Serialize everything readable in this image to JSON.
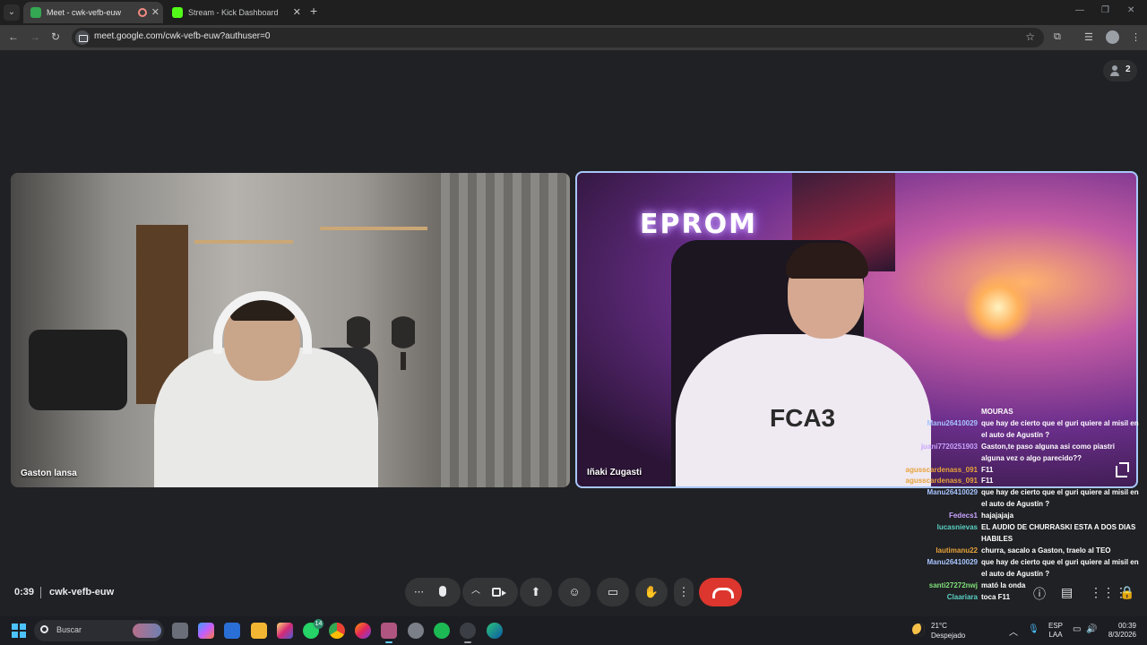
{
  "browser": {
    "tabs": [
      {
        "title": "Meet - cwk-vefb-euw",
        "active": true,
        "favicon_color": "#34a853"
      },
      {
        "title": "Stream - Kick Dashboard",
        "active": false,
        "favicon_color": "#53fc18"
      }
    ],
    "url": "meet.google.com/cwk-vefb-euw?authuser=0"
  },
  "meet": {
    "participant_count": "2",
    "tiles": [
      {
        "name": "Gaston lansa"
      },
      {
        "name": "Iñaki Zugasti"
      }
    ],
    "neon_sign": "EPROM",
    "shirt_text": "FCA3",
    "chat": [
      {
        "user": "",
        "text": "MOURAS",
        "color": "#ffffff"
      },
      {
        "user": "Manu26410029",
        "text": "que hay de cierto que el guri quiere al misil en el auto de Agustín ?",
        "color": "#a7c4ff"
      },
      {
        "user": "juani7720251903",
        "text": "Gaston,te paso alguna asi como piastri alguna vez o algo parecido??",
        "color": "#c9a3ff"
      },
      {
        "user": "agusscardenass_091",
        "text": "F11",
        "color": "#e8a33a"
      },
      {
        "user": "agusscardenass_091",
        "text": "F11",
        "color": "#e8a33a"
      },
      {
        "user": "Manu26410029",
        "text": "que hay de cierto que el guri quiere al misil en el auto de Agustín ?",
        "color": "#a7c4ff"
      },
      {
        "user": "Fedecs1",
        "text": "hajajajaja",
        "color": "#c9a3ff"
      },
      {
        "user": "lucasnievas",
        "text": "EL AUDIO DE CHURRASKI ESTA A DOS DIAS HABILES",
        "color": "#5ad1c4"
      },
      {
        "user": "lautimanu22",
        "text": "churra, sacalo a Gaston, traelo al TEO",
        "color": "#e8a33a"
      },
      {
        "user": "Manu26410029",
        "text": "que hay de cierto que el guri quiere al misil en el auto de Agustín ?",
        "color": "#a7c4ff"
      },
      {
        "user": "santi27272nwj",
        "text": "mató la onda",
        "color": "#7fe07a"
      },
      {
        "user": "Claariara",
        "text": "toca F11",
        "color": "#5ad1c4"
      }
    ],
    "time": "0:39",
    "meeting_code": "cwk-vefb-euw"
  },
  "taskbar": {
    "search_placeholder": "Buscar",
    "whatsapp_badge": "14",
    "weather_temp": "21°C",
    "weather_desc": "Despejado",
    "lang_line1": "ESP",
    "lang_line2": "LAA",
    "clock_time": "00:39",
    "clock_date": "8/3/2026"
  }
}
